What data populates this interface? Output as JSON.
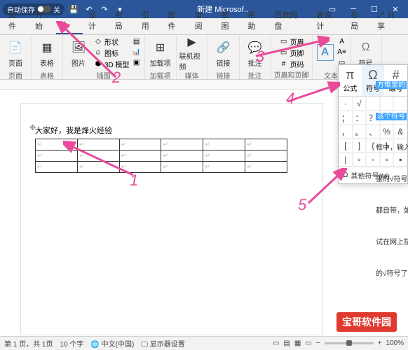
{
  "titlebar": {
    "autosave_label": "自动保存",
    "autosave_state": "关",
    "doc_title": "新建 Microsof…"
  },
  "tabs": {
    "items": [
      "文件",
      "开始",
      "插入",
      "设计",
      "布局",
      "引用",
      "邮件",
      "审阅",
      "视图",
      "帮助",
      "百度网盘",
      "表设计",
      "布局"
    ],
    "active_index": 2,
    "share": "共享"
  },
  "ribbon": {
    "groups": [
      {
        "label": "页面",
        "items": [
          {
            "label": "页面",
            "icon": "📄"
          }
        ]
      },
      {
        "label": "表格",
        "items": [
          {
            "label": "表格",
            "icon": "▦"
          }
        ]
      },
      {
        "label": "插图",
        "items": [
          {
            "label": "图片",
            "icon": "🖼"
          }
        ],
        "small": [
          "形状",
          "图标",
          "3D 模型"
        ]
      },
      {
        "label": "",
        "items": [],
        "small": [
          "",
          ""
        ]
      },
      {
        "label": "加载项",
        "items": [
          {
            "label": "加载项",
            "icon": "⊞"
          }
        ]
      },
      {
        "label": "媒体",
        "items": [
          {
            "label": "联机视频",
            "icon": "▶"
          }
        ]
      },
      {
        "label": "链接",
        "items": [
          {
            "label": "链接",
            "icon": "🔗"
          }
        ]
      },
      {
        "label": "批注",
        "items": [
          {
            "label": "批注",
            "icon": "💬"
          }
        ]
      },
      {
        "label": "页眉和页脚",
        "items": [
          {
            "label": "页眉",
            "icon": "▭"
          }
        ],
        "small": [
          "页眉",
          "页脚",
          "页码"
        ]
      },
      {
        "label": "文本",
        "items": [
          {
            "label": "",
            "icon": "A"
          }
        ],
        "small": [
          "",
          "",
          ""
        ]
      },
      {
        "label": "符号",
        "items": [
          {
            "label": "符号",
            "icon": "Ω"
          }
        ]
      }
    ]
  },
  "document": {
    "text": "大家好，我是烽火经验",
    "cell_marker": "↵"
  },
  "symbol_panel": {
    "tabs": [
      {
        "label": "公式",
        "icon": "π"
      },
      {
        "label": "符号",
        "icon": "Ω"
      },
      {
        "label": "编号",
        "icon": "#"
      }
    ],
    "active_tab": 1,
    "grid": [
      "·",
      "√",
      "",
      "",
      "",
      "；",
      "：",
      "？",
      "",
      "",
      "，",
      "。",
      "、",
      "%",
      "&",
      "[",
      "]",
      "{",
      "}",
      "",
      "|",
      "▫",
      "◦",
      "▫",
      "▪"
    ],
    "more_label": "其他符号(M)…"
  },
  "side": {
    "frags": [
      "方框里的",
      "这个符号",
      "框中，输入方框",
      "里的√符号了，如",
      "都自带，如果在",
      "试在网上搜索并",
      "的√符号了，有"
    ]
  },
  "annotations": {
    "nums": [
      "1",
      "2",
      "3",
      "4",
      "5"
    ]
  },
  "status": {
    "page": "第 1 页，共 1页",
    "words": "10 个字",
    "lang": "中文(中国)",
    "display": "显示器设置",
    "zoom": "100%"
  },
  "watermark": "宝哥软件园"
}
